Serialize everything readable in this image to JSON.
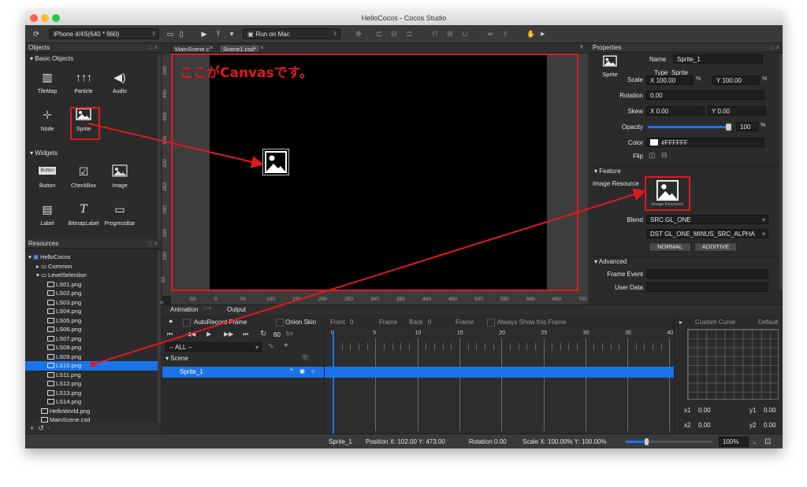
{
  "window": {
    "title": "HelloCocos - Cocos Studio"
  },
  "toolbar": {
    "device": "iPhone 4/4S(640 * 960)",
    "run_label": "Run on Mac"
  },
  "objects_panel": {
    "title": "Objects",
    "basic_header": "Basic Objects",
    "basic_items": [
      "TileMap",
      "Particle",
      "Audio",
      "Node",
      "Sprite"
    ],
    "widgets_header": "Widgets",
    "widget_items": [
      "Button",
      "CheckBox",
      "Image",
      "Label",
      "BitmapLabel",
      "ProgressBar"
    ],
    "button_icon_text": "Button"
  },
  "resources": {
    "title": "Resources",
    "root": "HelloCocos",
    "common": "Common",
    "level_folder": "LevelSelection",
    "files": [
      "LS01.png",
      "LS02.png",
      "LS03.png",
      "LS04.png",
      "LS05.png",
      "LS06.png",
      "LS07.png",
      "LS08.png",
      "LS09.png",
      "LS10.png",
      "LS11.png",
      "LS12.png",
      "LS13.png",
      "LS14.png"
    ],
    "selected": "LS10.png",
    "extra_files": [
      "HelloWorld.png",
      "MainScene.csd"
    ]
  },
  "canvas": {
    "tabs": [
      "MainScene.c",
      "Scene1.csd*"
    ],
    "annotation": "ここがCanvasです。",
    "ruler_x": [
      "-50",
      "0",
      "50",
      "100",
      "150",
      "200",
      "250",
      "300",
      "350",
      "400",
      "450",
      "500",
      "550",
      "600",
      "650",
      "700"
    ],
    "ruler_y": [
      "500",
      "450",
      "400",
      "350",
      "300",
      "250",
      "200",
      "150",
      "100",
      "50",
      "0"
    ]
  },
  "properties": {
    "title": "Properties",
    "sprite_label": "Sprite",
    "name_label": "Name",
    "name_value": "Sprite_1",
    "type_label": "Type",
    "type_value": "Sprite",
    "scale_label": "Scale",
    "scale_x": "100.00",
    "scale_y": "100.00",
    "pct": "%",
    "rotation_label": "Rotation",
    "rotation_value": "0.00",
    "skew_label": "Skew",
    "skew_x": "0.00",
    "skew_y": "0.00",
    "opacity_label": "Opacity",
    "opacity_value": "100",
    "opacity_level": 100,
    "color_label": "Color",
    "color_value": "#FFFFFF",
    "flip_label": "Flip",
    "feature_header": "Feature",
    "image_resource_label": "Image Resource",
    "image_resource_caption": "Image Resource",
    "blend_label": "Blend",
    "blend_src": "SRC GL_ONE",
    "blend_dst": "DST GL_ONE_MINUS_SRC_ALPHA",
    "normal_btn": "NORMAL",
    "additive_btn": "ADDITIVE",
    "advanced_header": "Advanced",
    "frame_event_label": "Frame Event",
    "user_data_label": "User Data",
    "x_label": "X",
    "y_label": "Y"
  },
  "animation": {
    "tab": "Animation",
    "output_tab": "Output",
    "autorecord": "AutoRecord Frame",
    "onion": "Onion Skin",
    "front_label": "Front",
    "front_value": "0",
    "frame_label": "Frame",
    "back_label": "Back",
    "back_value": "0",
    "frame_label2": "Frame",
    "always_show": "Always Show this Frame",
    "fps_value": "60",
    "fps_label": "fps",
    "filter": "-- ALL --",
    "scene_label": "Scene",
    "track": "Sprite_1",
    "ticks": [
      "0",
      "5",
      "10",
      "15",
      "20",
      "25",
      "30",
      "35",
      "40"
    ],
    "curve_label": "Custom Curve",
    "curve_default": "Default",
    "x1": "x1",
    "x1_val": "0.00",
    "y1": "y1",
    "y1_val": "0.00",
    "x2": "x2",
    "x2_val": "0.00",
    "y2": "y2",
    "y2_val": "0.00"
  },
  "status": {
    "object": "Sprite_1",
    "position": "Position X: 102.00  Y: 473.00",
    "rotation": "Rotation 0.00",
    "scale": "Scale X: 100.00%  Y: 100.00%",
    "zoom": "100%"
  },
  "colors": {
    "accent": "#1a73e8",
    "highlight": "#e0191e",
    "panel": "#2b2b2b"
  }
}
